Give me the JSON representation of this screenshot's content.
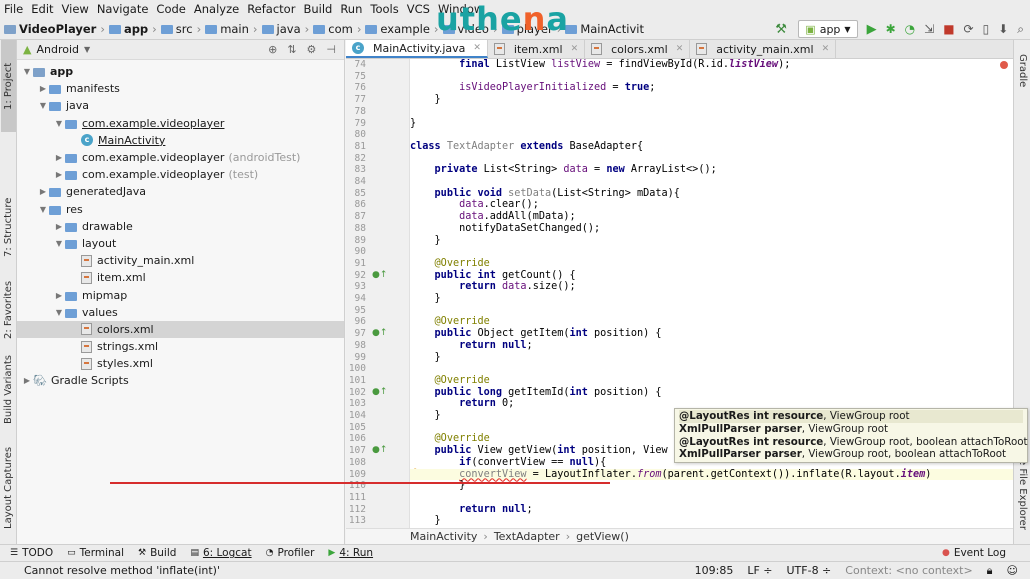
{
  "menu": [
    "File",
    "Edit",
    "View",
    "Navigate",
    "Code",
    "Analyze",
    "Refactor",
    "Build",
    "Run",
    "Tools",
    "VCS",
    "Window"
  ],
  "nav": {
    "root": "VideoPlayer",
    "crumbs": [
      "app",
      "src",
      "main",
      "java",
      "com",
      "example",
      "video",
      "player",
      "MainActivit"
    ]
  },
  "logo": {
    "text_left": "uthe",
    "text_o": "n",
    "text_right": "a"
  },
  "toolbar": {
    "run_config": "app"
  },
  "left_tabs": [
    "1: Project",
    "7: Structure",
    "2: Favorites",
    "Build Variants",
    "Layout Captures"
  ],
  "right_tabs": [
    "Gradle",
    "Device File Explorer"
  ],
  "project": {
    "mode": "Android",
    "items": [
      {
        "label": "app",
        "depth": 0,
        "type": "module",
        "open": true
      },
      {
        "label": "manifests",
        "depth": 1,
        "type": "folder",
        "open": false
      },
      {
        "label": "java",
        "depth": 1,
        "type": "folder",
        "open": true
      },
      {
        "label": "com.example.videoplayer",
        "depth": 2,
        "type": "folder",
        "open": true,
        "underline": true
      },
      {
        "label": "MainActivity",
        "depth": 3,
        "type": "class",
        "underline": true
      },
      {
        "label": "com.example.videoplayer",
        "depth": 2,
        "type": "folder",
        "open": false,
        "suffix": "(androidTest)"
      },
      {
        "label": "com.example.videoplayer",
        "depth": 2,
        "type": "folder",
        "open": false,
        "suffix": "(test)"
      },
      {
        "label": "generatedJava",
        "depth": 1,
        "type": "folder",
        "open": false
      },
      {
        "label": "res",
        "depth": 1,
        "type": "folder",
        "open": true
      },
      {
        "label": "drawable",
        "depth": 2,
        "type": "folder",
        "open": false
      },
      {
        "label": "layout",
        "depth": 2,
        "type": "folder",
        "open": true
      },
      {
        "label": "activity_main.xml",
        "depth": 3,
        "type": "xml"
      },
      {
        "label": "item.xml",
        "depth": 3,
        "type": "xml"
      },
      {
        "label": "mipmap",
        "depth": 2,
        "type": "folder",
        "open": false
      },
      {
        "label": "values",
        "depth": 2,
        "type": "folder",
        "open": true
      },
      {
        "label": "colors.xml",
        "depth": 3,
        "type": "xml",
        "selected": true
      },
      {
        "label": "strings.xml",
        "depth": 3,
        "type": "xml"
      },
      {
        "label": "styles.xml",
        "depth": 3,
        "type": "xml"
      },
      {
        "label": "Gradle Scripts",
        "depth": 0,
        "type": "gradle",
        "open": false
      }
    ]
  },
  "tabs": [
    {
      "label": "MainActivity.java",
      "icon": "c",
      "active": true
    },
    {
      "label": "item.xml",
      "icon": "xml"
    },
    {
      "label": "colors.xml",
      "icon": "xml"
    },
    {
      "label": "activity_main.xml",
      "icon": "xml"
    }
  ],
  "code": [
    {
      "n": 74,
      "html": "        <span class=\"kw\">final</span> ListView <span class=\"mem\">listView</span> = findViewById(R.id.<span class=\"it\">listView</span>);"
    },
    {
      "n": 75,
      "html": ""
    },
    {
      "n": 76,
      "html": "        <span class=\"mem\">isVideoPlayerInitialized</span> = <span class=\"kw\">true</span>;"
    },
    {
      "n": 77,
      "html": "    }"
    },
    {
      "n": 78,
      "html": ""
    },
    {
      "n": 79,
      "html": "}"
    },
    {
      "n": 80,
      "html": ""
    },
    {
      "n": 81,
      "html": "<span class=\"kw\">class</span> <span class=\"gr\">TextAdapter</span> <span class=\"kw\">extends</span> BaseAdapter{"
    },
    {
      "n": 82,
      "html": ""
    },
    {
      "n": 83,
      "html": "    <span class=\"kw\">private</span> List&lt;String&gt; <span class=\"mem\">data</span> = <span class=\"kw\">new</span> ArrayList&lt;&gt;();"
    },
    {
      "n": 84,
      "html": ""
    },
    {
      "n": 85,
      "html": "    <span class=\"kw\">public void</span> <span class=\"gr\">setData</span>(List&lt;String&gt; mData){"
    },
    {
      "n": 86,
      "html": "        <span class=\"mem\">data</span>.clear();"
    },
    {
      "n": 87,
      "html": "        <span class=\"mem\">data</span>.addAll(mData);"
    },
    {
      "n": 88,
      "html": "        notifyDataSetChanged();"
    },
    {
      "n": 89,
      "html": "    }"
    },
    {
      "n": 90,
      "html": ""
    },
    {
      "n": 91,
      "html": "    <span class=\"an\">@Override</span>"
    },
    {
      "n": 92,
      "html": "    <span class=\"kw\">public int</span> getCount() {",
      "gm": true
    },
    {
      "n": 93,
      "html": "        <span class=\"kw\">return</span> <span class=\"mem\">data</span>.size();"
    },
    {
      "n": 94,
      "html": "    }"
    },
    {
      "n": 95,
      "html": ""
    },
    {
      "n": 96,
      "html": "    <span class=\"an\">@Override</span>"
    },
    {
      "n": 97,
      "html": "    <span class=\"kw\">public</span> Object getItem(<span class=\"kw\">int</span> position) {",
      "gm": true
    },
    {
      "n": 98,
      "html": "        <span class=\"kw\">return null</span>;"
    },
    {
      "n": 99,
      "html": "    }"
    },
    {
      "n": 100,
      "html": ""
    },
    {
      "n": 101,
      "html": "    <span class=\"an\">@Override</span>"
    },
    {
      "n": 102,
      "html": "    <span class=\"kw\">public long</span> getItemId(<span class=\"kw\">int</span> position) {",
      "gm": true
    },
    {
      "n": 103,
      "html": "        <span class=\"kw\">return</span> 0;"
    },
    {
      "n": 104,
      "html": "    }"
    },
    {
      "n": 105,
      "html": ""
    },
    {
      "n": 106,
      "html": "    <span class=\"an\">@Override</span>"
    },
    {
      "n": 107,
      "html": "    <span class=\"kw\">public</span> View getView(<span class=\"kw\">int</span> position, View co",
      "gm": true
    },
    {
      "n": 108,
      "html": "        <span class=\"kw\">if</span>(convertView == <span class=\"kw\">null</span>){"
    },
    {
      "n": 109,
      "html": "        <span class=\"un\">convertView</span> = LayoutInflater.<span class=\"it\" style=\"font-weight:normal\">from</span>(parent.getContext()).inflate(R.layout.<span class=\"it\">item</span>)",
      "hl": true,
      "bulb": true
    },
    {
      "n": 110,
      "html": "        }"
    },
    {
      "n": 111,
      "html": ""
    },
    {
      "n": 112,
      "html": "        <span class=\"kw\">return null</span>;"
    },
    {
      "n": 113,
      "html": "    }"
    }
  ],
  "popup": [
    {
      "bold": "@LayoutRes int resource",
      "rest": ", ViewGroup root"
    },
    {
      "bold": "XmlPullParser parser",
      "rest": ", ViewGroup root"
    },
    {
      "bold": "@LayoutRes int resource",
      "rest": ", ViewGroup root, boolean attachToRoot"
    },
    {
      "bold": "XmlPullParser parser",
      "rest": ", ViewGroup root, boolean attachToRoot"
    }
  ],
  "breadcrumb": [
    "MainActivity",
    "TextAdapter",
    "getView()"
  ],
  "bottom_tools": [
    "TODO",
    "Terminal",
    "Build",
    "6: Logcat",
    "Profiler",
    "4: Run"
  ],
  "event_log": "Event Log",
  "status": {
    "message": "Cannot resolve method 'inflate(int)'",
    "position": "109:85",
    "line_sep": "LF ÷",
    "encoding": "UTF-8 ÷",
    "context": "Context: <no context>"
  }
}
